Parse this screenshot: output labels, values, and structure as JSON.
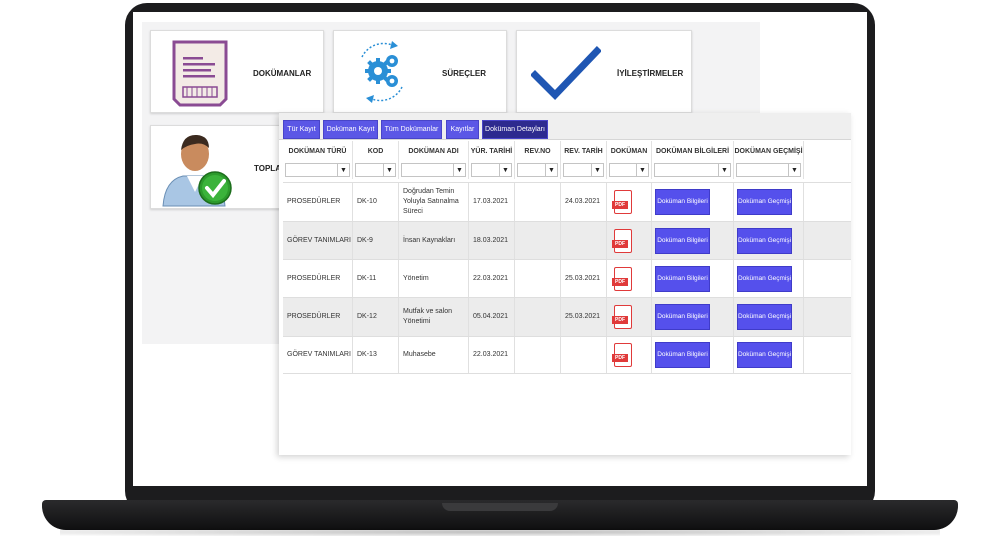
{
  "tiles": {
    "documents": "DOKÜMANLAR",
    "processes": "SÜREÇLER",
    "improvements": "İYİLEŞTİRMELER",
    "meetings": "TOPLAN"
  },
  "tabs": [
    {
      "label": "Tür Kayıt"
    },
    {
      "label": "Doküman Kayıt"
    },
    {
      "label": "Tüm Dokümanlar"
    },
    {
      "label": "Kayıtlar"
    },
    {
      "label": "Doküman Detayları"
    }
  ],
  "table": {
    "headers": [
      "DOKÜMAN TÜRÜ",
      "KOD",
      "DOKÜMAN ADI",
      "YÜR. TARİHİ",
      "REV.NO",
      "REV. TARİH",
      "DOKÜMAN",
      "DOKÜMAN BİLGİLERİ",
      "DOKÜMAN GEÇMİŞİ"
    ],
    "filter_icon": "▼",
    "pdf_label": "PDF",
    "info_button": "Doküman Bilgileri",
    "history_button": "Doküman Geçmişi",
    "rows": [
      {
        "type": "PROSEDÜRLER",
        "code": "DK-10",
        "name": "Doğrudan Temin Yoluyla Satınalma Süreci",
        "date": "17.03.2021",
        "rev_no": "",
        "rev_date": "24.03.2021"
      },
      {
        "type": "GÖREV TANIMLARI",
        "code": "DK-9",
        "name": "İnsan Kaynakları",
        "date": "18.03.2021",
        "rev_no": "",
        "rev_date": ""
      },
      {
        "type": "PROSEDÜRLER",
        "code": "DK-11",
        "name": "Yönetim",
        "date": "22.03.2021",
        "rev_no": "",
        "rev_date": "25.03.2021"
      },
      {
        "type": "PROSEDÜRLER",
        "code": "DK-12",
        "name": "Mutfak ve salon Yönetimi",
        "date": "05.04.2021",
        "rev_no": "",
        "rev_date": "25.03.2021"
      },
      {
        "type": "GÖREV TANIMLARI",
        "code": "DK-13",
        "name": "Muhasebe",
        "date": "22.03.2021",
        "rev_no": "",
        "rev_date": ""
      }
    ]
  },
  "colors": {
    "tab": "#5b57e6",
    "tab_active": "#2d2a8f",
    "button": "#5550ec",
    "pdf": "#e03a3a",
    "check": "#1f56b3",
    "gear": "#2a8fd6"
  },
  "icons": [
    "document-icon",
    "gears-icon",
    "checkmark-icon",
    "user-approved-icon",
    "filter-icon",
    "pdf-icon"
  ]
}
